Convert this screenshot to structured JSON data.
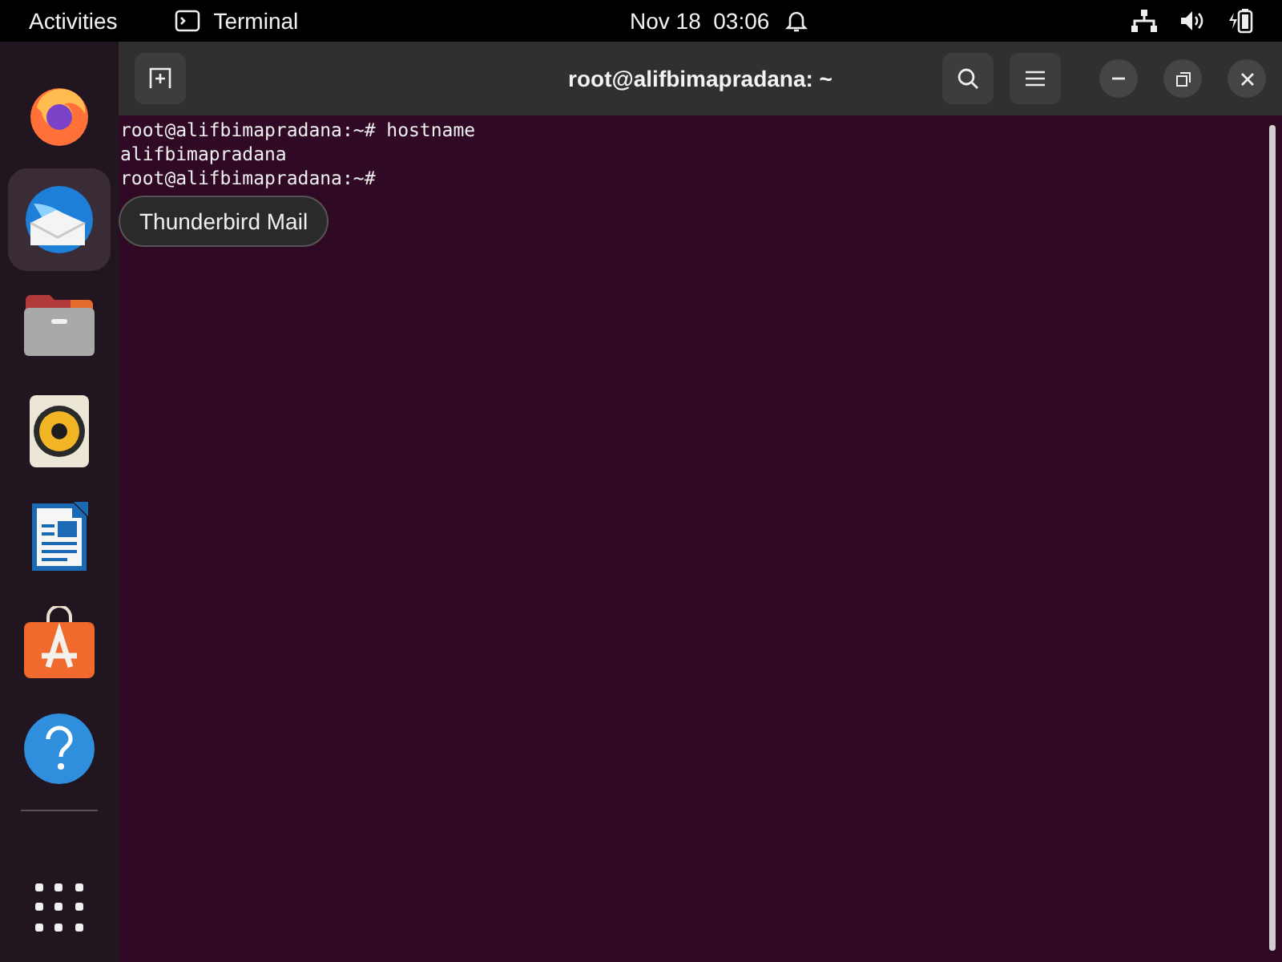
{
  "top_bar": {
    "activities": "Activities",
    "app_name": "Terminal",
    "date": "Nov 18",
    "time": "03:06"
  },
  "dock": {
    "apps": [
      {
        "kind": "firefox",
        "selected": false
      },
      {
        "kind": "thunderbird",
        "selected": true
      },
      {
        "kind": "files",
        "selected": false
      },
      {
        "kind": "music",
        "selected": false
      },
      {
        "kind": "writer",
        "selected": false
      },
      {
        "kind": "store",
        "selected": false
      },
      {
        "kind": "help",
        "selected": false
      }
    ],
    "tooltip": "Thunderbird Mail"
  },
  "terminal": {
    "title": "root@alifbimapradana: ~",
    "lines": [
      "root@alifbimapradana:~# hostname",
      "alifbimapradana",
      "root@alifbimapradana:~#"
    ]
  }
}
